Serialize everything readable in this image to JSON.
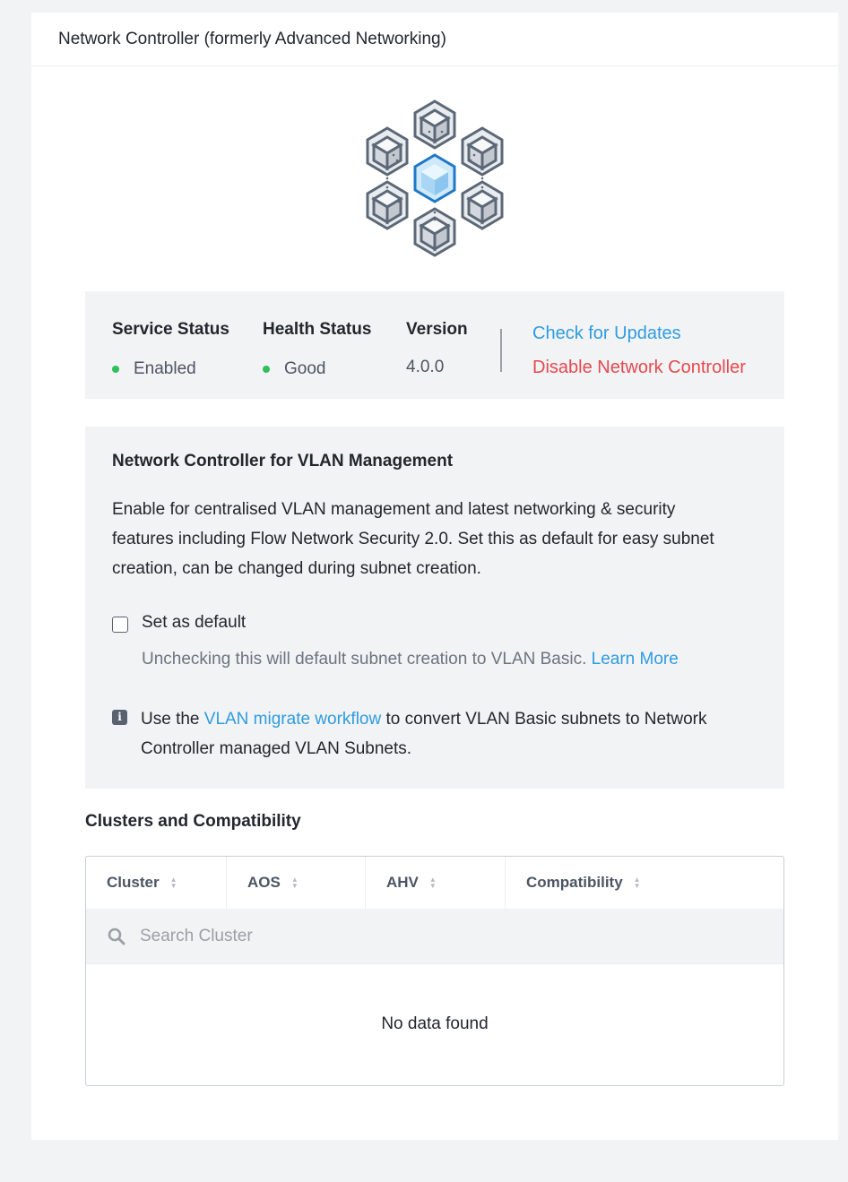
{
  "panel": {
    "title": "Network Controller (formerly Advanced Networking)"
  },
  "status": {
    "service_label": "Service Status",
    "service_value": "Enabled",
    "health_label": "Health Status",
    "health_value": "Good",
    "version_label": "Version",
    "version_value": "4.0.0",
    "status_dot_color": "#2fbf5c",
    "check_updates": "Check for Updates",
    "disable": "Disable Network Controller"
  },
  "vlan": {
    "title": "Network Controller for VLAN Management",
    "description": "Enable for centralised VLAN management and latest networking & security features including Flow Network Security 2.0. Set this as default for easy subnet creation, can be changed during subnet creation.",
    "checkbox_label": "Set as default",
    "checkbox_checked": false,
    "hint": "Unchecking this will default subnet creation to VLAN Basic.",
    "learn_more": "Learn More",
    "info_prefix": "Use the",
    "info_link": "VLAN migrate workflow",
    "info_suffix": "to convert VLAN Basic subnets to Network Controller managed VLAN Subnets."
  },
  "clusters": {
    "title": "Clusters and Compatibility",
    "columns": [
      "Cluster",
      "AOS",
      "AHV",
      "Compatibility"
    ],
    "search_placeholder": "Search Cluster",
    "empty_text": "No data found"
  },
  "colors": {
    "link": "#2e9ce0",
    "danger": "#e5484d",
    "accent_cube": "#1f78c8"
  },
  "icons": [
    "hexagon-cubes-icon",
    "info-icon",
    "search-icon",
    "sort-icon"
  ]
}
